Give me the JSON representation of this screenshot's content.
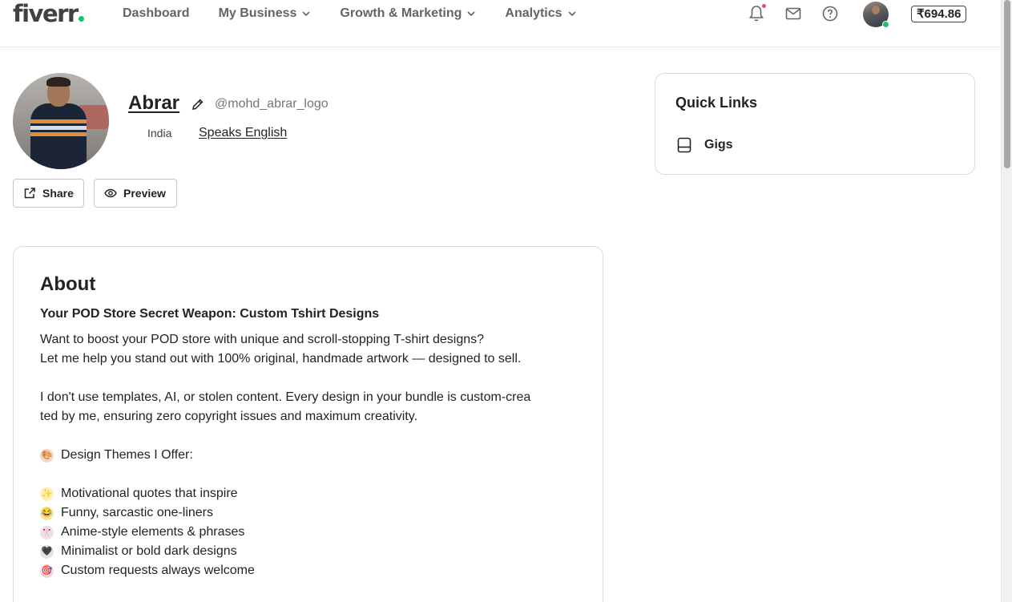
{
  "header": {
    "logo": "fiverr",
    "nav": [
      {
        "label": "Dashboard",
        "has_dropdown": false
      },
      {
        "label": "My Business",
        "has_dropdown": true
      },
      {
        "label": "Growth & Marketing",
        "has_dropdown": true
      },
      {
        "label": "Analytics",
        "has_dropdown": true
      }
    ],
    "icons": [
      "bell-icon",
      "mail-icon",
      "help-icon"
    ],
    "balance": "₹694.86"
  },
  "profile": {
    "name": "Abrar",
    "username": "@mohd_abrar_logo",
    "country": "India",
    "speaks": "Speaks English",
    "share_label": "Share",
    "preview_label": "Preview"
  },
  "about": {
    "title": "About",
    "subtitle": "Your POD Store Secret Weapon: Custom Tshirt Designs",
    "lines": [
      {
        "text": " Want to boost your POD store with unique and scroll-stopping T-shirt designs?",
        "emoji": null
      },
      {
        "text": "Let me help you stand out with 100% original, handmade artwork — designed to sell.",
        "emoji": null
      },
      {
        "text": "",
        "emoji": null
      },
      {
        "text": "I don't use templates, AI, or stolen content. Every design in your bundle is custom-crea",
        "emoji": null
      },
      {
        "text": "ted by me, ensuring zero copyright issues and maximum creativity.",
        "emoji": null
      },
      {
        "text": "",
        "emoji": null
      },
      {
        "text": "Design Themes I Offer:",
        "emoji": "🎨"
      },
      {
        "text": "",
        "emoji": null
      },
      {
        "text": "Motivational quotes that inspire",
        "emoji": "✨"
      },
      {
        "text": "Funny, sarcastic one-liners",
        "emoji": "😂"
      },
      {
        "text": "Anime-style elements & phrases",
        "emoji": "🎌"
      },
      {
        "text": "Minimalist or bold dark designs",
        "emoji": "🖤"
      },
      {
        "text": "Custom requests always welcome",
        "emoji": "🎯"
      }
    ]
  },
  "quick_links": {
    "title": "Quick Links",
    "items": [
      {
        "label": "Gigs",
        "icon": "gigs-icon"
      }
    ]
  },
  "colors": {
    "brand_green": "#1dbf73",
    "notification": "#e04a86",
    "text": "#222325",
    "muted": "#62646a"
  }
}
